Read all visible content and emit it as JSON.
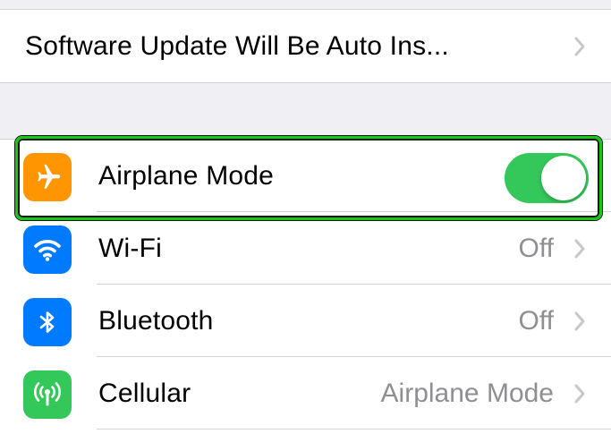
{
  "software_update": {
    "label": "Software Update Will Be Auto Ins..."
  },
  "settings_rows": {
    "airplane_mode": {
      "label": "Airplane Mode",
      "icon": "airplane-icon",
      "icon_color": "#ff9500",
      "toggle_on": true,
      "toggle_color": "#34c759"
    },
    "wifi": {
      "label": "Wi-Fi",
      "value": "Off",
      "icon": "wifi-icon",
      "icon_color": "#007aff"
    },
    "bluetooth": {
      "label": "Bluetooth",
      "value": "Off",
      "icon": "bluetooth-icon",
      "icon_color": "#007aff"
    },
    "cellular": {
      "label": "Cellular",
      "value": "Airplane Mode",
      "icon": "cellular-icon",
      "icon_color": "#34c759"
    }
  },
  "highlight_color": "#19c519"
}
